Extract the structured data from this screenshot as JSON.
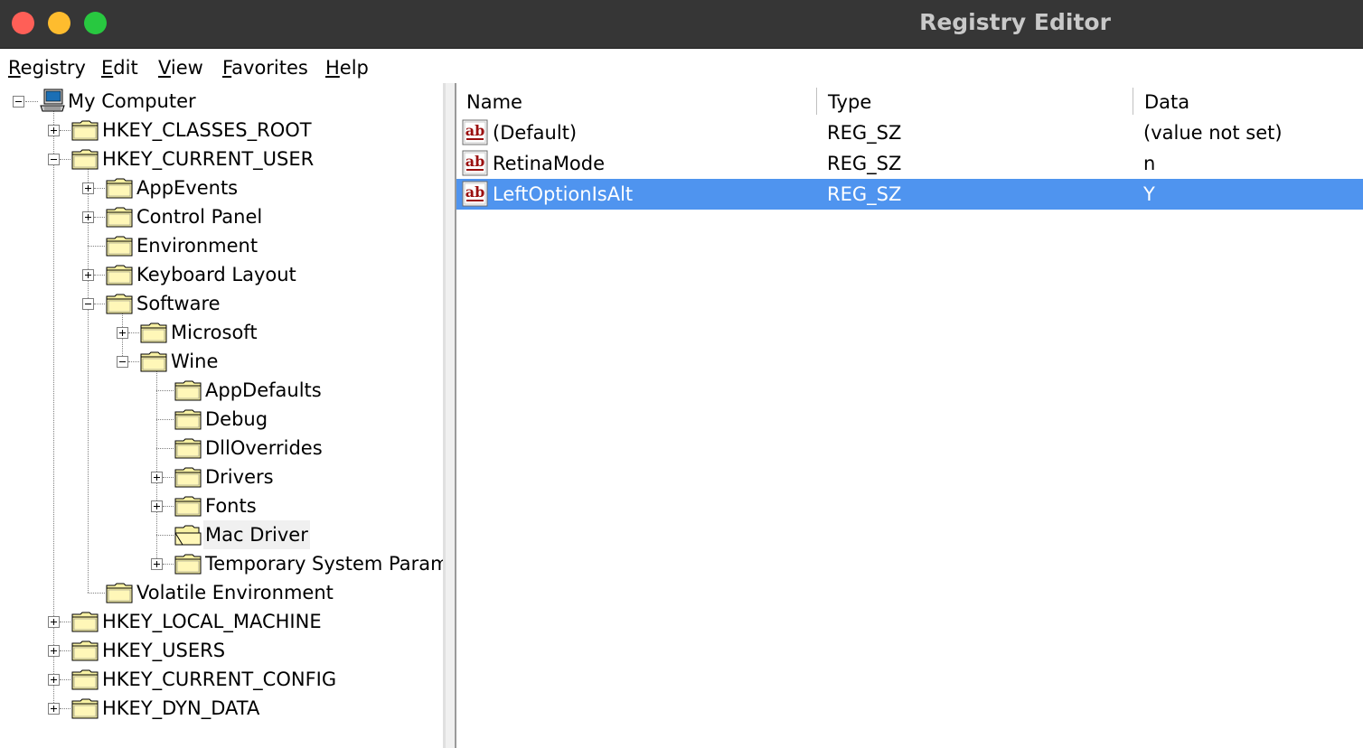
{
  "window": {
    "title": "Registry Editor"
  },
  "menu": [
    "Registry",
    "Edit",
    "View",
    "Favorites",
    "Help"
  ],
  "tree": {
    "root": "My Computer",
    "classes_root": "HKEY_CLASSES_ROOT",
    "current_user": "HKEY_CURRENT_USER",
    "app_events": "AppEvents",
    "control_panel": "Control Panel",
    "environment": "Environment",
    "keyboard_layout": "Keyboard Layout",
    "software": "Software",
    "microsoft": "Microsoft",
    "wine": "Wine",
    "app_defaults": "AppDefaults",
    "debug": "Debug",
    "dll_overrides": "DllOverrides",
    "drivers": "Drivers",
    "fonts": "Fonts",
    "mac_driver": "Mac Driver",
    "temp_params": "Temporary System Paramet",
    "volatile_env": "Volatile Environment",
    "local_machine": "HKEY_LOCAL_MACHINE",
    "users": "HKEY_USERS",
    "current_config": "HKEY_CURRENT_CONFIG",
    "dyn_data": "HKEY_DYN_DATA"
  },
  "list": {
    "headers": {
      "name": "Name",
      "type": "Type",
      "data": "Data"
    },
    "rows": [
      {
        "name": "(Default)",
        "type": "REG_SZ",
        "data": "(value not set)"
      },
      {
        "name": "RetinaMode",
        "type": "REG_SZ",
        "data": "n"
      },
      {
        "name": "LeftOptionIsAlt",
        "type": "REG_SZ",
        "data": "Y"
      }
    ]
  },
  "colors": {
    "selection": "#4f94ef",
    "titlebar": "#363636",
    "folder": "#fff6a8"
  },
  "icons": {
    "folder": "folder-icon",
    "computer": "computer-icon",
    "string_value": "string-value-icon",
    "expand": "plus-box-icon",
    "collapse": "minus-box-icon"
  }
}
